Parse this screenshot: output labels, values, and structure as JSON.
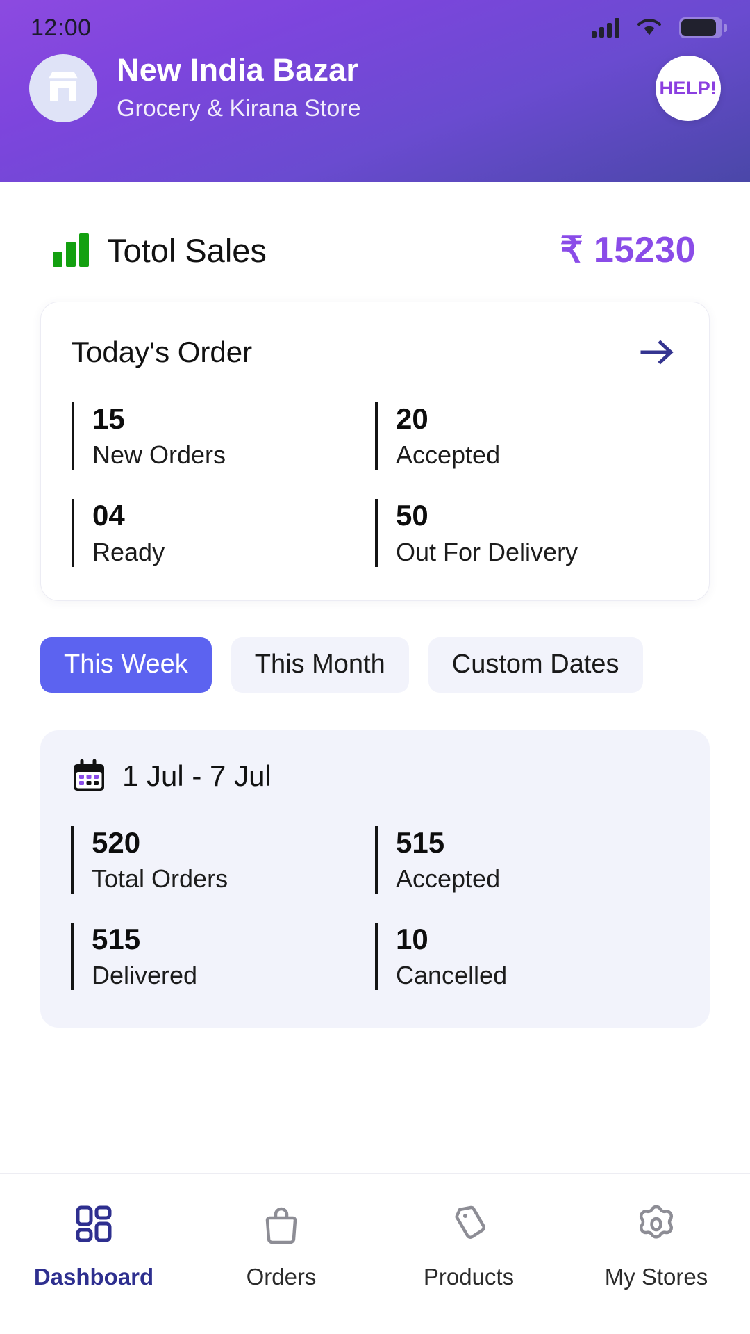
{
  "status_bar": {
    "time": "12:00",
    "icons": [
      "signal-icon",
      "wifi-icon",
      "battery-icon"
    ]
  },
  "header": {
    "store_icon": "storefront-icon",
    "store_name": "New India Bazar",
    "store_subtitle": "Grocery & Kirana Store",
    "help_label": "HELP!",
    "gradient_from": "#8c4ae0",
    "gradient_to": "#4a47a8"
  },
  "sales": {
    "icon": "bar-chart-icon",
    "label": "Totol Sales",
    "currency": "₹",
    "amount": "15230",
    "amount_color": "#8a4ce8"
  },
  "todays_order": {
    "title": "Today's Order",
    "arrow_icon": "arrow-right-icon",
    "stats": [
      {
        "value": "15",
        "label": "New Orders"
      },
      {
        "value": "20",
        "label": "Accepted"
      },
      {
        "value": "04",
        "label": "Ready"
      },
      {
        "value": "50",
        "label": "Out For Delivery"
      }
    ]
  },
  "range_tabs": {
    "active_index": 0,
    "items": [
      {
        "label": "This Week"
      },
      {
        "label": "This Month"
      },
      {
        "label": "Custom Dates"
      }
    ],
    "active_color": "#5c63f0",
    "idle_color": "#f2f3fb"
  },
  "period_summary": {
    "calendar_icon": "calendar-icon",
    "date_range": "1 Jul - 7 Jul",
    "stats": [
      {
        "value": "520",
        "label": "Total Orders"
      },
      {
        "value": "515",
        "label": "Accepted"
      },
      {
        "value": "515",
        "label": "Delivered"
      },
      {
        "value": "10",
        "label": "Cancelled"
      }
    ]
  },
  "bottom_nav": {
    "active_index": 0,
    "active_color": "#2e2f8f",
    "items": [
      {
        "label": "Dashboard",
        "icon": "grid-dashboard-icon"
      },
      {
        "label": "Orders",
        "icon": "shopping-bag-icon"
      },
      {
        "label": "Products",
        "icon": "price-tag-icon"
      },
      {
        "label": "My Stores",
        "icon": "gear-icon"
      }
    ]
  }
}
